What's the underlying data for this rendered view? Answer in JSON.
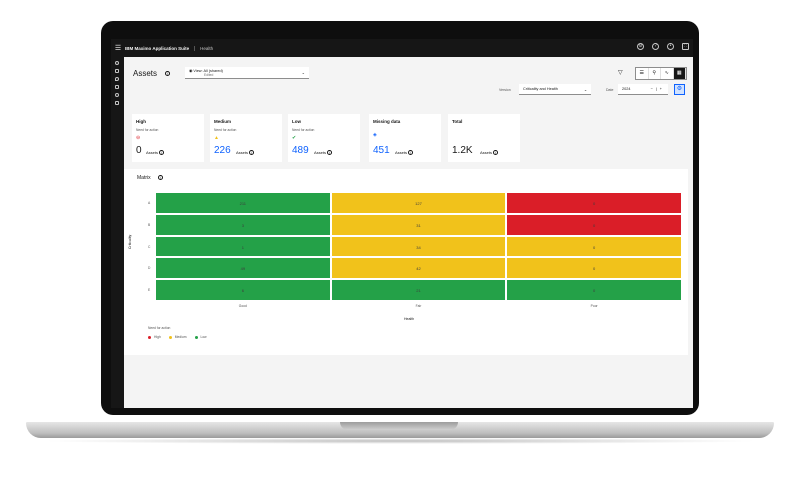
{
  "app": {
    "brand": "IBM Maximo Application Suite",
    "crumb": "Health",
    "menu_icon": "menu-icon",
    "top_icons": [
      "settings-icon",
      "help-icon",
      "user-icon",
      "apps-grid-icon"
    ]
  },
  "sidenav": {
    "icons": [
      "search-icon",
      "wrench-icon",
      "location-icon",
      "list-icon",
      "view-icon",
      "swap-icon"
    ]
  },
  "page": {
    "title": "Assets",
    "view_label": "View: All (shared)",
    "view_sub": "Edited",
    "version_label": "Version",
    "version_value": "Criticality and Health",
    "date_label": "Date",
    "date_value": "2024",
    "toolbar_icons": [
      "list-view-icon",
      "map-icon",
      "chart-icon",
      "matrix-icon"
    ]
  },
  "cards": [
    {
      "title": "High",
      "subtitle": "Need for action",
      "value": "0",
      "unit": "Assets",
      "icon_color": "#da1e28",
      "value_color": "#161616"
    },
    {
      "title": "Medium",
      "subtitle": "Need for action",
      "value": "226",
      "unit": "Assets",
      "icon_color": "#f1c21b",
      "value_color": "#0f62fe"
    },
    {
      "title": "Low",
      "subtitle": "Need for action",
      "value": "489",
      "unit": "Assets",
      "icon_color": "#24a148",
      "value_color": "#0f62fe"
    },
    {
      "title": "Missing data",
      "subtitle": "",
      "value": "451",
      "unit": "Assets",
      "icon_color": "#0f62fe",
      "value_color": "#0f62fe"
    },
    {
      "title": "Total",
      "subtitle": "",
      "value": "1.2K",
      "unit": "Assets",
      "icon_color": "",
      "value_color": "#161616"
    }
  ],
  "matrix": {
    "title": "Matrix",
    "ylabel": "Criticality",
    "xlabel": "Health",
    "rows": [
      "A",
      "B",
      "C",
      "D",
      "E"
    ],
    "cols": [
      "Good",
      "Fair",
      "Poor"
    ],
    "values": [
      [
        211,
        127,
        0
      ],
      [
        3,
        31,
        0
      ],
      [
        1,
        34,
        0
      ],
      [
        49,
        42,
        0
      ],
      [
        6,
        21,
        0
      ]
    ],
    "colors": [
      [
        "#24a148",
        "#f1c21b",
        "#da1e28"
      ],
      [
        "#24a148",
        "#f1c21b",
        "#da1e28"
      ],
      [
        "#24a148",
        "#f1c21b",
        "#f1c21b"
      ],
      [
        "#24a148",
        "#f1c21b",
        "#f1c21b"
      ],
      [
        "#24a148",
        "#24a148",
        "#24a148"
      ]
    ],
    "legend_title": "Need for action",
    "legend": [
      {
        "label": "High",
        "color": "#da1e28"
      },
      {
        "label": "Medium",
        "color": "#f1c21b"
      },
      {
        "label": "Low",
        "color": "#24a148"
      }
    ]
  }
}
